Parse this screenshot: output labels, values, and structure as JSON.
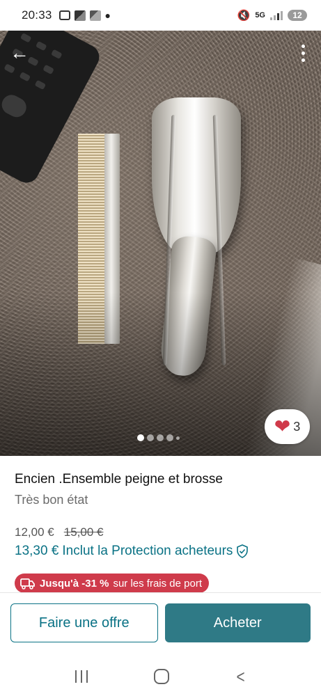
{
  "status_bar": {
    "time": "20:33",
    "network": "5G",
    "battery": "12"
  },
  "photo": {
    "description_icon": "item-photo",
    "carousel_count": 5,
    "carousel_active": 1,
    "favorites_count": "3"
  },
  "item": {
    "title": "Encien .Ensemble peigne et brosse",
    "condition": "Très bon état",
    "price": "12,00 €",
    "old_price": "15,00 €",
    "total_price": "13,30 €",
    "protection_label": "Inclut la Protection acheteurs"
  },
  "promo": {
    "bold_text": "Jusqu'à -31 %",
    "text": "sur les frais de port"
  },
  "actions": {
    "offer_label": "Faire une offre",
    "buy_label": "Acheter"
  },
  "colors": {
    "accent": "#0a7285",
    "buy_button": "#2f7a86",
    "promo": "#cf3b4b",
    "heart": "#d03a4a"
  }
}
